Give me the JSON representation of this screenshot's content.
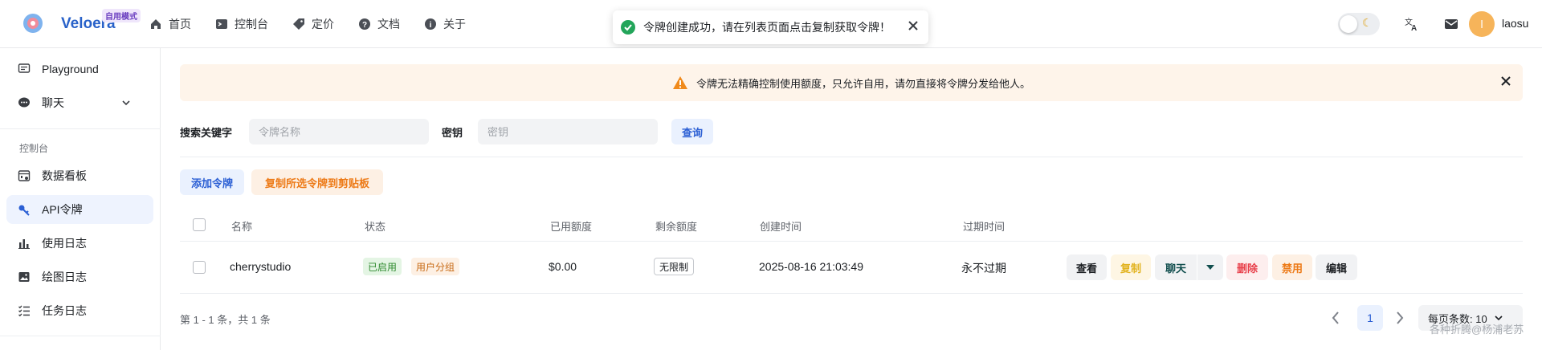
{
  "header": {
    "brand": "Veloera",
    "badge": "自用模式",
    "nav": [
      {
        "label": "首页",
        "icon": "home-icon"
      },
      {
        "label": "控制台",
        "icon": "terminal-icon"
      },
      {
        "label": "定价",
        "icon": "tag-icon"
      },
      {
        "label": "文档",
        "icon": "help-icon"
      },
      {
        "label": "关于",
        "icon": "info-icon"
      }
    ],
    "toast": "令牌创建成功，请在列表页面点击复制获取令牌！",
    "avatar_initial": "l",
    "username": "laosu"
  },
  "sidebar": {
    "items": [
      {
        "label": "Playground",
        "icon": "message-square-icon"
      },
      {
        "label": "聊天",
        "icon": "chat-icon"
      }
    ],
    "section": "控制台",
    "console_items": [
      {
        "label": "数据看板",
        "icon": "calendar-chart-icon"
      },
      {
        "label": "API令牌",
        "icon": "key-icon"
      },
      {
        "label": "使用日志",
        "icon": "bar-chart-icon"
      },
      {
        "label": "绘图日志",
        "icon": "image-icon"
      },
      {
        "label": "任务日志",
        "icon": "checklist-icon"
      }
    ]
  },
  "main": {
    "banner": "令牌无法精确控制使用额度，只允许自用，请勿直接将令牌分发给他人。",
    "search": {
      "label": "搜索关键字",
      "name_placeholder": "令牌名称",
      "key_label": "密钥",
      "key_placeholder": "密钥",
      "query": "查询"
    },
    "add_token": "添加令牌",
    "copy_selected": "复制所选令牌到剪贴板",
    "columns": [
      "名称",
      "状态",
      "已用额度",
      "剩余额度",
      "创建时间",
      "过期时间"
    ],
    "rows": [
      {
        "name": "cherrystudio",
        "status": "已启用",
        "group": "用户分组",
        "used": "$0.00",
        "remaining": "无限制",
        "created": "2025-08-16 21:03:49",
        "expires": "永不过期"
      }
    ],
    "actions": {
      "view": "查看",
      "copy": "复制",
      "chat": "聊天",
      "delete": "删除",
      "disable": "禁用",
      "edit": "编辑"
    },
    "pager": {
      "info": "第 1 - 1 条，共 1 条",
      "current_page": "1",
      "page_size": "每页条数: 10"
    },
    "watermark": "各种折腾@杨浦老苏"
  },
  "colors": {
    "accent": "#2b5fd4",
    "warning_bg": "#fef4ea",
    "success": "#23a55a",
    "danger": "#e8404b",
    "orange": "#ed7a17"
  }
}
